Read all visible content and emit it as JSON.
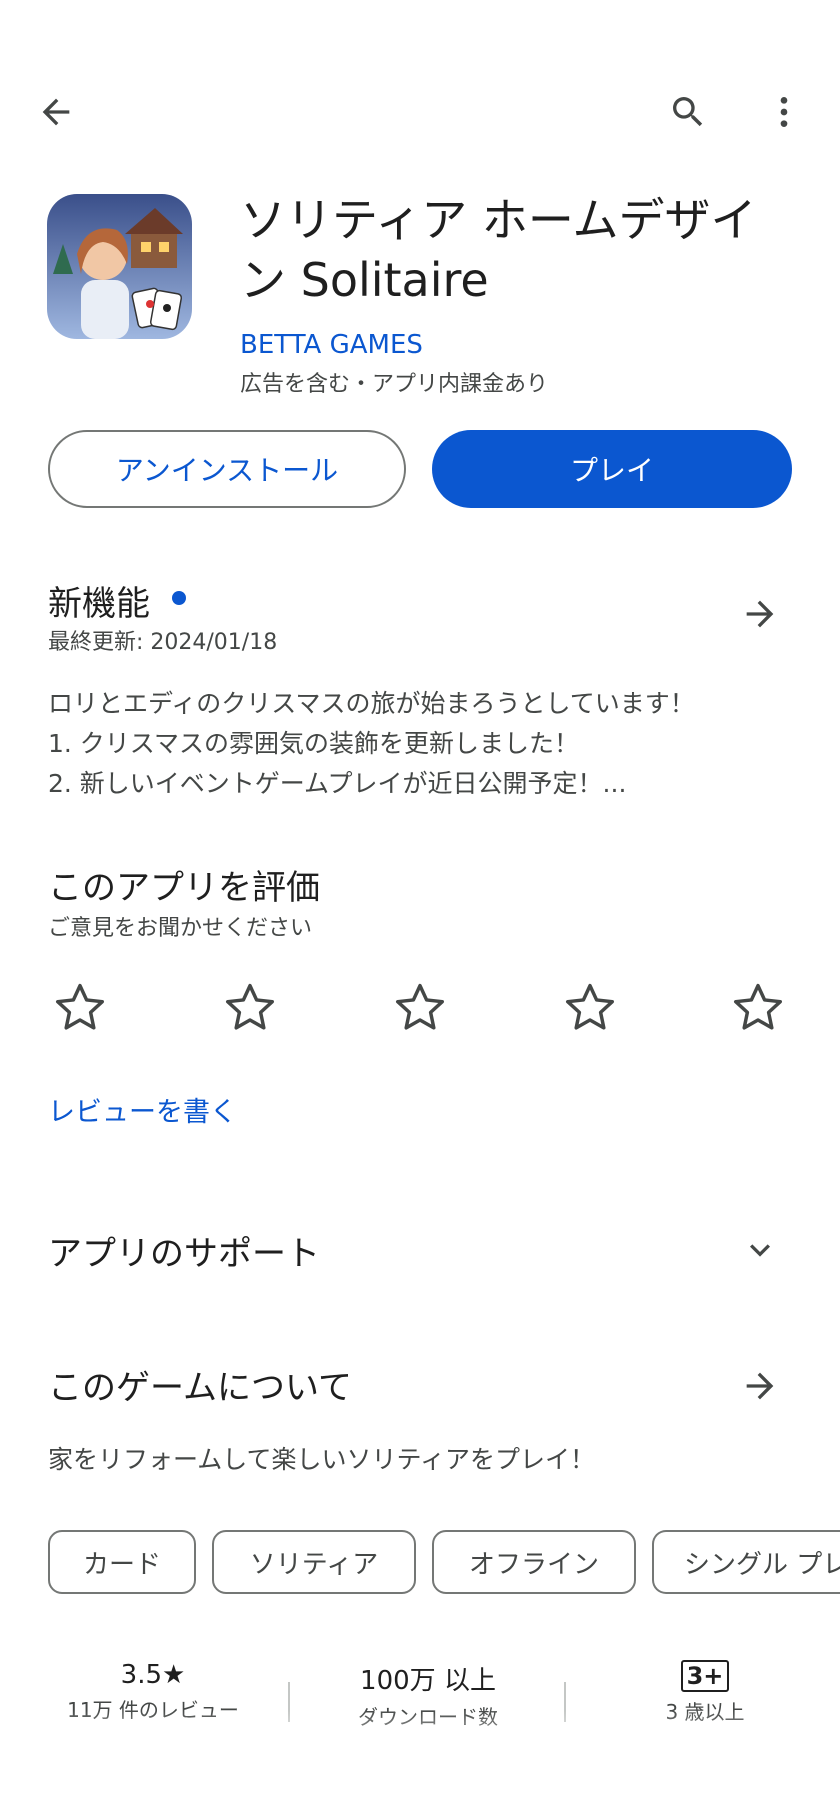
{
  "app": {
    "title": "ソリティア ホームデザイン Solitaire",
    "developer": "BETTA GAMES",
    "ads_info": "広告を含む・アプリ内課金あり"
  },
  "buttons": {
    "uninstall": "アンインストール",
    "play": "プレイ"
  },
  "whats_new": {
    "title": "新機能",
    "updated": "最終更新: 2024/01/18",
    "lines": [
      "ロリとエディのクリスマスの旅が始まろうとしています！",
      "1. クリスマスの雰囲気の装飾を更新しました！",
      "2. 新しいイベントゲームプレイが近日公開予定！..."
    ]
  },
  "rate": {
    "title": "このアプリを評価",
    "subtitle": "ご意見をお聞かせください",
    "write_review": "レビューを書く"
  },
  "support": {
    "title": "アプリのサポート"
  },
  "about": {
    "title": "このゲームについて",
    "description": "家をリフォームして楽しいソリティアをプレイ！"
  },
  "tags": [
    "カード",
    "ソリティア",
    "オフライン",
    "シングル プレ"
  ],
  "stats": {
    "rating_value": "3.5★",
    "rating_label": "11万 件のレビュー",
    "downloads_value": "100万 以上",
    "downloads_label": "ダウンロード数",
    "age_badge": "3+",
    "age_label": "3 歳以上"
  },
  "colors": {
    "accent": "#0b57d0",
    "text": "#1f1f1f",
    "secondary": "#444746",
    "outline": "#747775"
  }
}
